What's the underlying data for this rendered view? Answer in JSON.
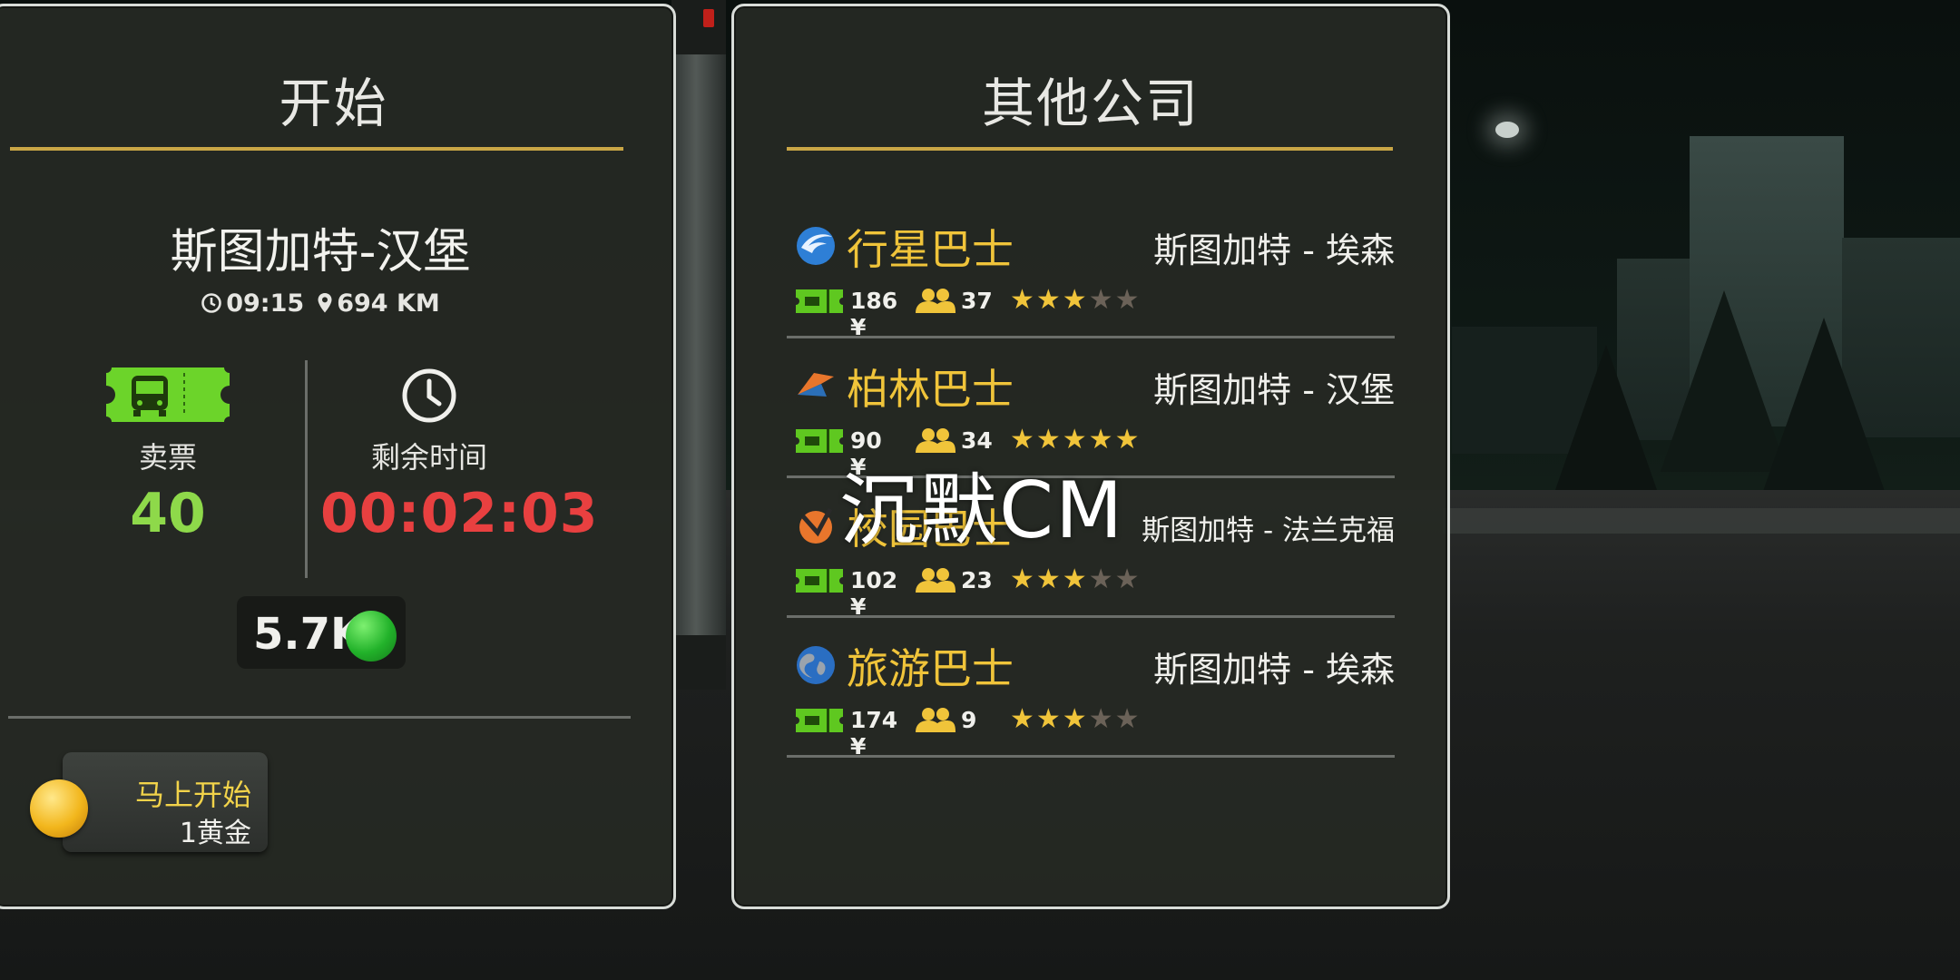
{
  "left_panel": {
    "title": "开始",
    "route": "斯图加特-汉堡",
    "time": "09:15",
    "distance": "694 KM",
    "tickets_label": "卖票",
    "tickets_value": "40",
    "remaining_label": "剩余时间",
    "remaining_value": "00:02:03",
    "money": "5.7K",
    "start_button": {
      "label": "马上开始",
      "cost": "1黄金"
    }
  },
  "right_panel": {
    "title": "其他公司",
    "companies": [
      {
        "name": "行星巴士",
        "route": "斯图加特 - 埃森",
        "price": "186 ¥",
        "passengers": "37",
        "rating": 3,
        "logo": "planet-bird-logo"
      },
      {
        "name": "柏林巴士",
        "route": "斯图加特 - 汉堡",
        "price": "90 ¥",
        "passengers": "34",
        "rating": 5,
        "logo": "berlin-logo"
      },
      {
        "name": "校园巴士",
        "route": "斯图加特 - 法兰克福",
        "price": "102 ¥",
        "passengers": "23",
        "rating": 3,
        "logo": "campus-logo"
      },
      {
        "name": "旅游巴士",
        "route": "斯图加特 - 埃森",
        "price": "174 ¥",
        "passengers": "9",
        "rating": 3,
        "logo": "globe-logo"
      }
    ]
  },
  "watermark": "沉默CM",
  "colors": {
    "gold": "#c9a646",
    "ticket_green": "#8ed94a",
    "timer_red": "#e84040",
    "company_gold": "#f0c43a"
  }
}
